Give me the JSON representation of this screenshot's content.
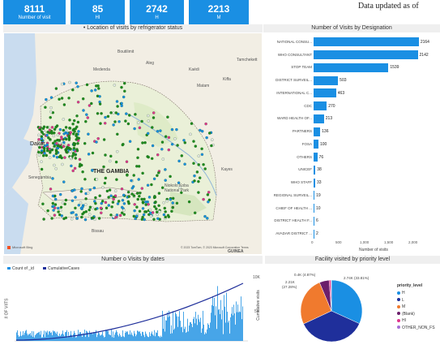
{
  "kpis": [
    {
      "value": "8111",
      "label": "Number of visit"
    },
    {
      "value": "85",
      "label": "HI"
    },
    {
      "value": "2742",
      "label": "H"
    },
    {
      "value": "2213",
      "label": "M"
    }
  ],
  "updated_text": "Data updated as of",
  "map_panel": {
    "title": "• Location of visits by refrigerator status",
    "places": {
      "boutilimit": "Boutilimit",
      "aleg": "Aleg",
      "tamchekett": "Tamchekett",
      "medenda": "Medenda",
      "kaedi": "Kaédi",
      "kiffa": "Kiffa",
      "matam": "Matam",
      "dakar": "Dakar",
      "kayes": "Kayes",
      "senegambia": "Senegambia",
      "gambia": "THE GAMBIA",
      "nkk": "Niokolo Koba National Park",
      "bissau": "Bissau"
    },
    "ms_logo": "Microsoft Bing",
    "attribution": "© 2023 TomTom, © 2023 Microsoft Corporation Terms",
    "country_bottom": "GUINEA"
  },
  "designation_panel": {
    "title": "Number of Visits by Designation",
    "xlabel": "Number of visits",
    "xticks": [
      "0",
      "500",
      "1,000",
      "1,500",
      "2,000"
    ],
    "bar_color": "#1a8fe3"
  },
  "chart_data": [
    {
      "type": "bar",
      "orientation": "horizontal",
      "title": "Number of Visits by Designation",
      "xlabel": "Number of visits",
      "xlim": [
        0,
        2200
      ],
      "categories": [
        "NATIONAL CONSU...",
        "WHO CONSULTANT",
        "STOP TEAM",
        "DISTRICT SURVEIL...",
        "INTERNATIONAL C...",
        "CDC",
        "WARD HEALTH OF...",
        "PARTNERS",
        "FOSA",
        "OTHERS",
        "UNICEF",
        "WHO STAFF",
        "REGIONAL SURVEIL...",
        "CHIEF OF HEALTH ...",
        "DISTRICT HEALTH F...",
        "AVADAR DISTRICT ..."
      ],
      "values": [
        2164,
        2142,
        1539,
        503,
        463,
        270,
        213,
        136,
        100,
        76,
        38,
        33,
        19,
        10,
        6,
        2
      ]
    },
    {
      "type": "line",
      "title": "Number o Visits by dates",
      "ylabel_left": "# OF VIITS",
      "ylabel_right": "Cumulative visits",
      "right_ticks": [
        "0K",
        "5K",
        "10K"
      ],
      "series": [
        {
          "name": "Count of _id"
        },
        {
          "name": "CumulativeCases"
        }
      ]
    },
    {
      "type": "pie",
      "title": "Facility visited by priority level",
      "legend_title": "priority_level",
      "slices": [
        {
          "label": "H",
          "value": 2740,
          "color": "#1a8fe3"
        },
        {
          "label": "L",
          "value": 3130,
          "color": "#1f2f9b"
        },
        {
          "label": "M",
          "value": 2210,
          "color": "#f07a2e"
        },
        {
          "label": "(Blank)",
          "value": 440,
          "color": "#6b1f6b"
        },
        {
          "label": "HI",
          "value": 85,
          "color": "#e0368f"
        },
        {
          "label": "OTHER_NON_FS",
          "value": 20,
          "color": "#a66fd6"
        }
      ],
      "callouts": [
        "0.4K (4.87%)",
        "2.21K (27.28%)",
        "2.74K (33.81%)"
      ]
    }
  ],
  "dates_panel": {
    "title": "Number o Visits by dates",
    "legend": [
      "Count of _id",
      "CumulativeCases"
    ],
    "ylabel_left": "# OF VIITS",
    "ylabel_right": "Cumulative visits",
    "yticks_right": [
      "10K",
      "5K",
      "0K"
    ],
    "bar_color": "#1a8fe3",
    "line_color": "#1f2f9b"
  },
  "pie_panel": {
    "title": "Facility visited by priority level",
    "legend_title": "priority_level",
    "callout_small": "0.4K (4.87%)",
    "callout_m": "2.21K",
    "callout_m_pct": "(27.28%)",
    "callout_h": "2.74K (33.81%)"
  }
}
